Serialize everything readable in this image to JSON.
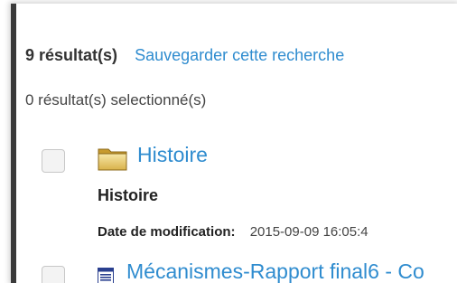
{
  "results_header": {
    "count": "9 résultat(s)",
    "save_search_link": "Sauvegarder cette recherche",
    "selected_count": "0 résultat(s) selectionné(s)"
  },
  "results": [
    {
      "icon": "folder-icon",
      "title": "Histoire",
      "subtitle": "Histoire",
      "meta_label": "Date de modification:",
      "meta_value": "2015-09-09 16:05:4"
    },
    {
      "icon": "document-icon",
      "title": "Mécanismes-Rapport final6 - Co"
    }
  ],
  "colors": {
    "link": "#2f8ccf",
    "rule": "#3a3a3a"
  }
}
